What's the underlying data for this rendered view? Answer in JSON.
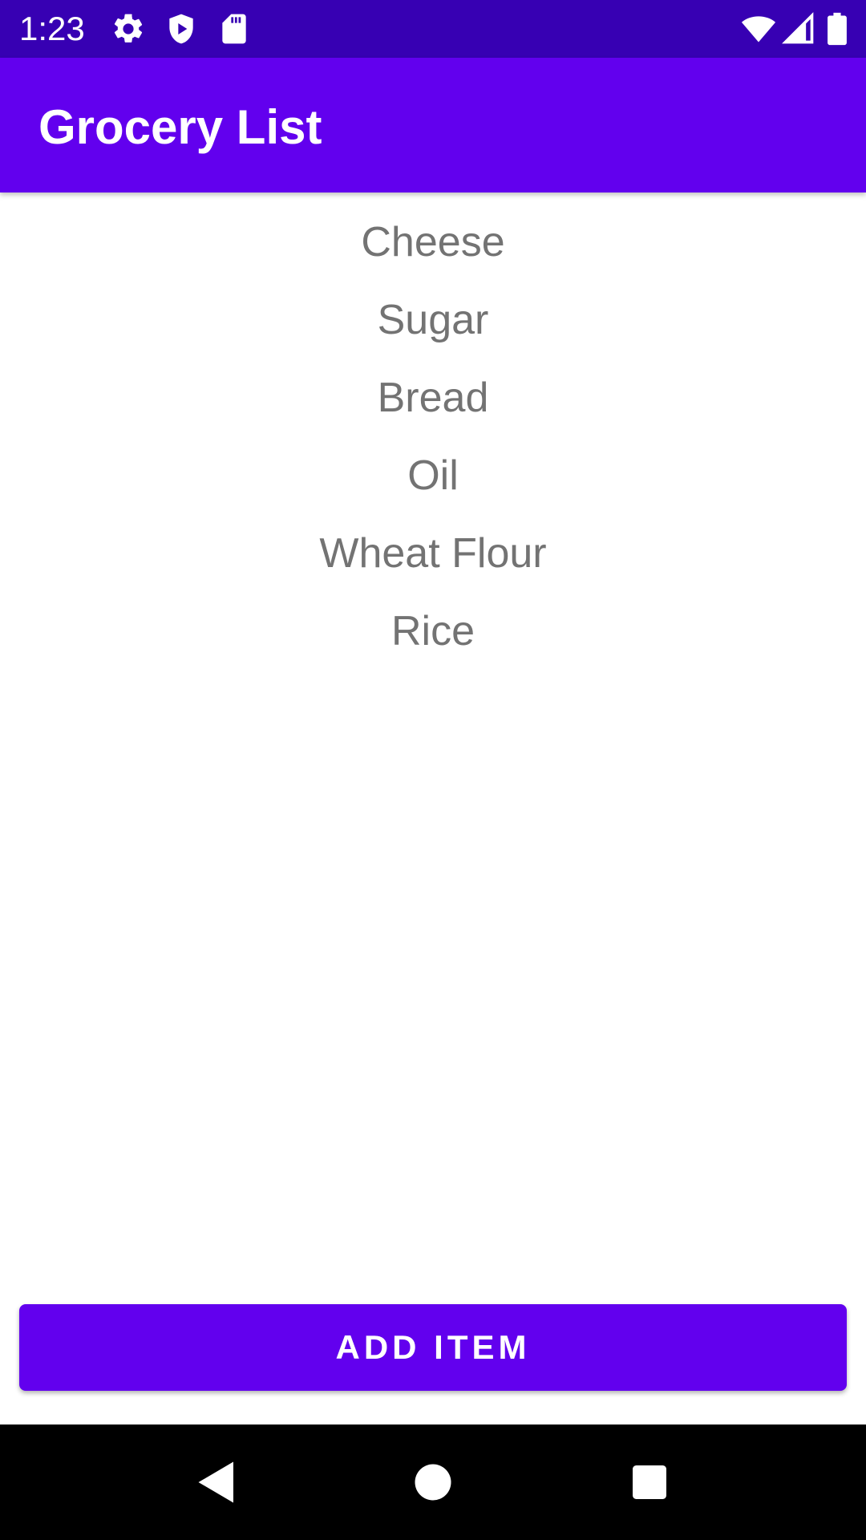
{
  "status_bar": {
    "time": "1:23",
    "icons_left": [
      "gear-icon",
      "shield-play-icon",
      "sd-card-icon"
    ],
    "icons_right": [
      "wifi-icon",
      "cell-signal-icon",
      "battery-icon"
    ],
    "background_color": "#3700b3"
  },
  "app_bar": {
    "title": "Grocery List",
    "background_color": "#6200ee"
  },
  "grocery_items": [
    {
      "label": "Cheese"
    },
    {
      "label": "Sugar"
    },
    {
      "label": "Bread"
    },
    {
      "label": "Oil"
    },
    {
      "label": "Wheat Flour"
    },
    {
      "label": "Rice"
    }
  ],
  "add_button": {
    "label": "ADD ITEM",
    "color": "#6200ee"
  },
  "nav_bar": {
    "buttons": [
      "back-icon",
      "home-icon",
      "recents-icon"
    ]
  }
}
